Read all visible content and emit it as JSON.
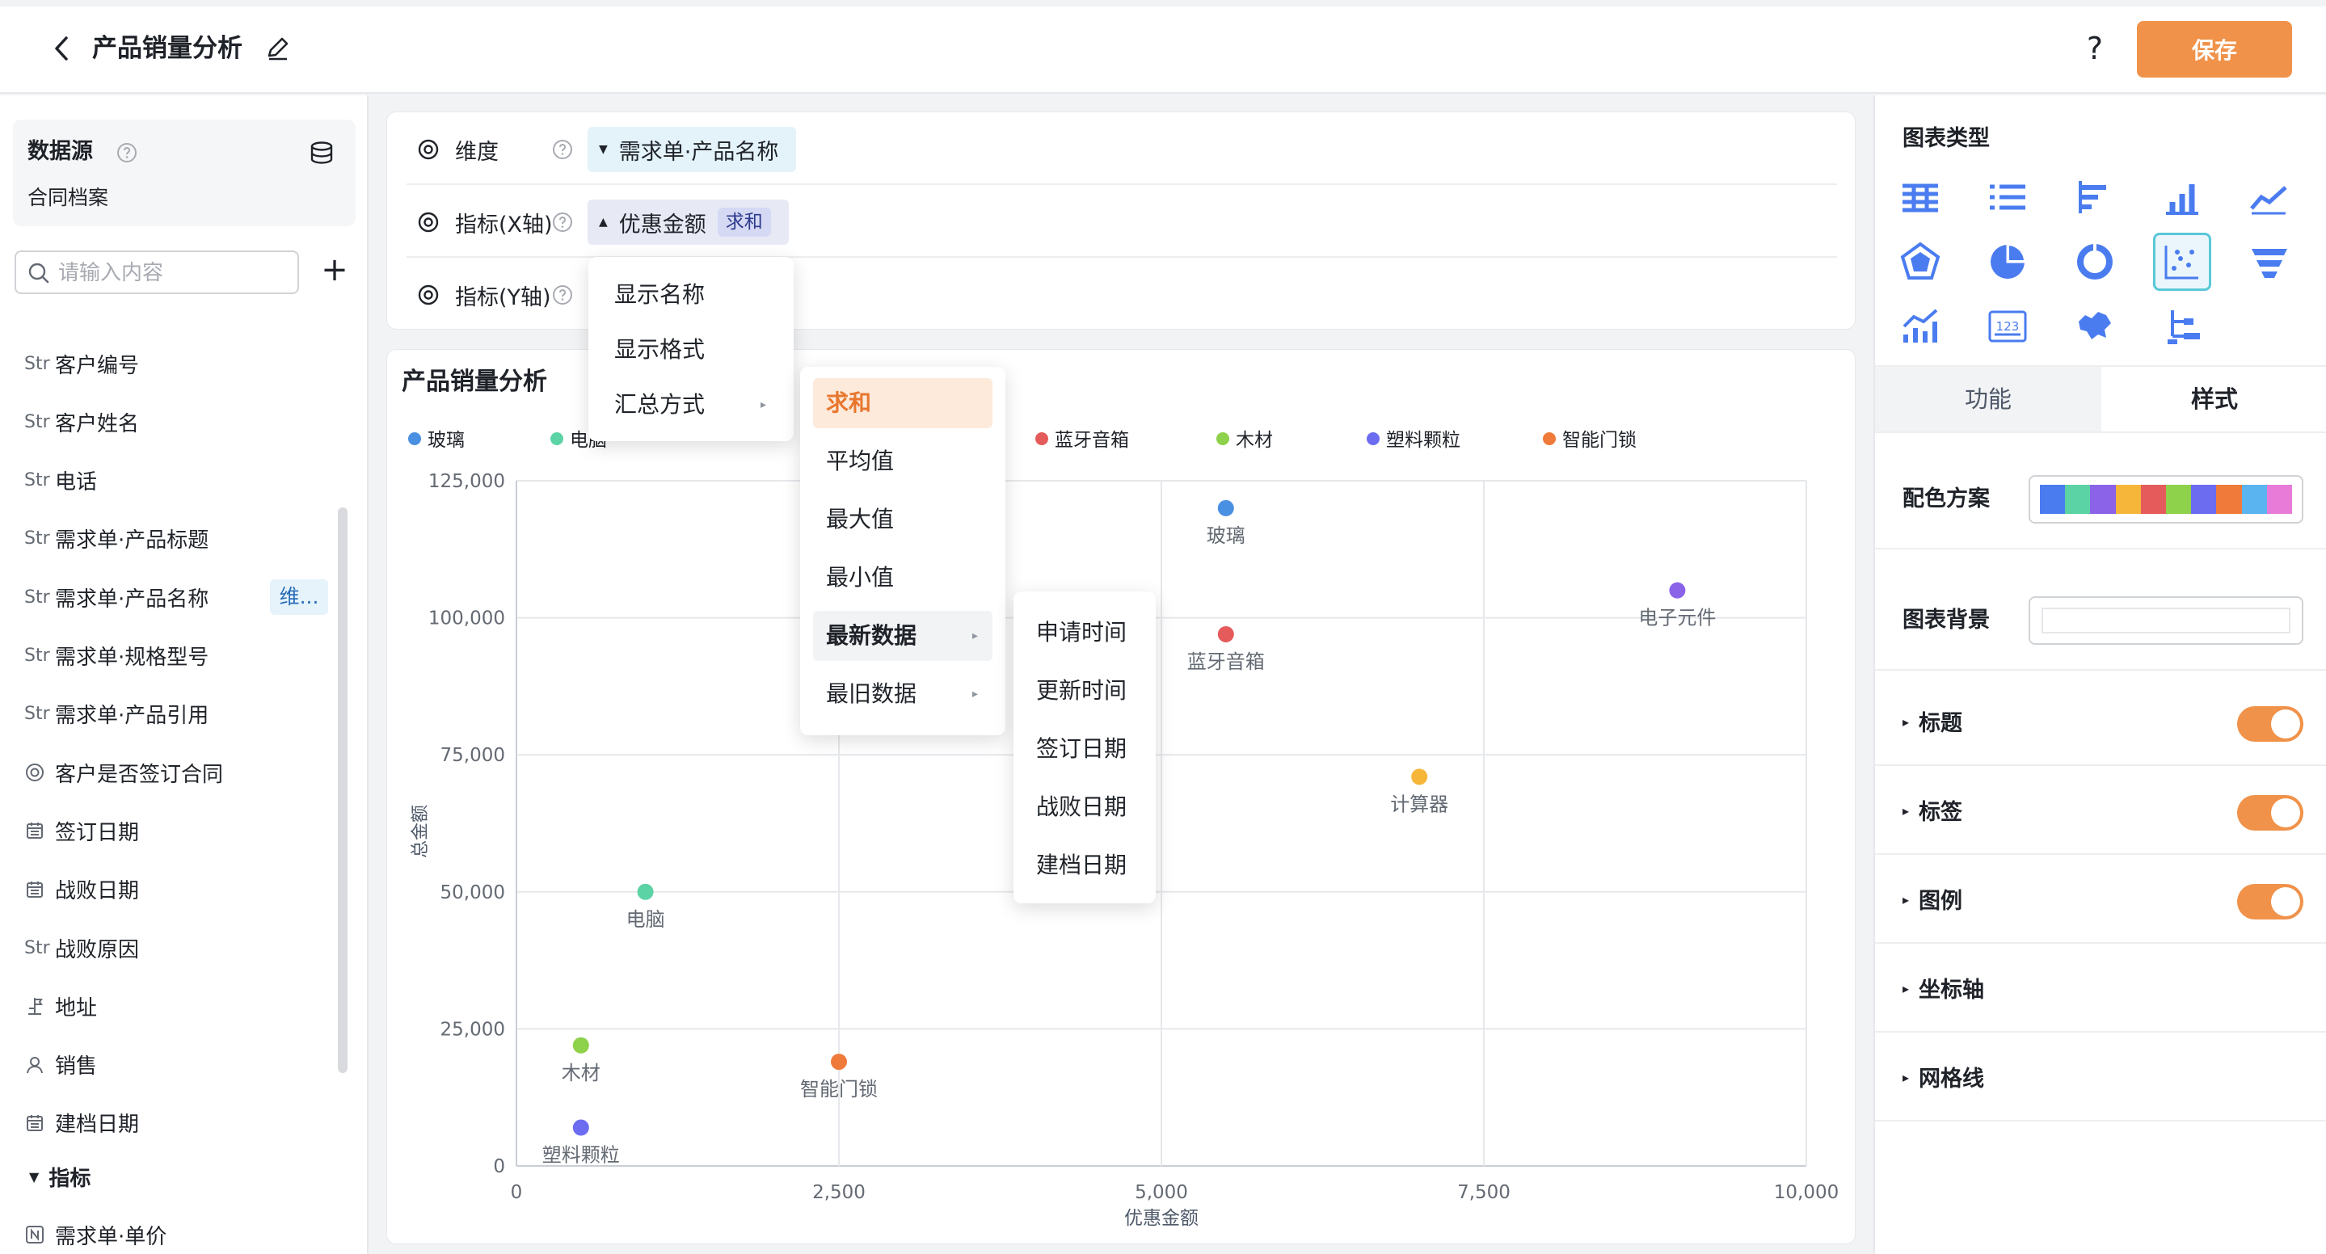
{
  "header": {
    "title": "产品销量分析",
    "help": "?",
    "save_label": "保存"
  },
  "sidebar": {
    "data_source_label": "数据源",
    "data_source_value": "合同档案",
    "search_placeholder": "请输入内容",
    "add": "+",
    "fields": [
      {
        "type": "Str",
        "label": "客户编号"
      },
      {
        "type": "Str",
        "label": "客户姓名"
      },
      {
        "type": "Str",
        "label": "电话"
      },
      {
        "type": "Str",
        "label": "需求单·产品标题"
      },
      {
        "type": "Str",
        "label": "需求单·产品名称",
        "badge": "维..."
      },
      {
        "type": "Str",
        "label": "需求单·规格型号"
      },
      {
        "type": "Str",
        "label": "需求单·产品引用"
      },
      {
        "type": "radio-icon",
        "label": "客户是否签订合同"
      },
      {
        "type": "calendar-icon",
        "label": "签订日期"
      },
      {
        "type": "calendar-icon",
        "label": "战败日期"
      },
      {
        "type": "Str",
        "label": "战败原因"
      },
      {
        "type": "location-icon",
        "label": "地址"
      },
      {
        "type": "user-icon",
        "label": "销售"
      },
      {
        "type": "calendar-icon",
        "label": "建档日期"
      }
    ],
    "metric_section": "指标",
    "metric_fields": [
      {
        "type": "number-icon",
        "label": "需求单·单价"
      }
    ]
  },
  "config": {
    "dimension_label": "维度",
    "dimension_value": "需求单·产品名称",
    "x_label": "指标(X轴)",
    "x_value": "优惠金额",
    "x_agg": "求和",
    "y_label": "指标(Y轴)"
  },
  "menus": {
    "menu1": [
      {
        "label": "显示名称"
      },
      {
        "label": "显示格式"
      },
      {
        "label": "汇总方式",
        "arrow": "▸"
      }
    ],
    "menu2": [
      {
        "label": "求和",
        "state": "active"
      },
      {
        "label": "平均值"
      },
      {
        "label": "最大值"
      },
      {
        "label": "最小值"
      },
      {
        "label": "最新数据",
        "arrow": "▸",
        "state": "hover"
      },
      {
        "label": "最旧数据",
        "arrow": "▸"
      }
    ],
    "menu3": [
      {
        "label": "申请时间"
      },
      {
        "label": "更新时间"
      },
      {
        "label": "签订日期"
      },
      {
        "label": "战败日期"
      },
      {
        "label": "建档日期"
      }
    ]
  },
  "chart": {
    "title": "产品销量分析"
  },
  "chart_data": {
    "type": "scatter",
    "title": "产品销量分析",
    "xlabel": "优惠金额",
    "ylabel": "总金额",
    "xlim": [
      0,
      10000
    ],
    "ylim": [
      0,
      125000
    ],
    "x_ticks": [
      "0",
      "2,500",
      "5,000",
      "7,500",
      "10,000"
    ],
    "y_ticks": [
      "0",
      "25,000",
      "50,000",
      "75,000",
      "100,000",
      "125,000"
    ],
    "grid": true,
    "legend_position": "top",
    "legend": [
      {
        "name": "玻璃",
        "color": "#4a90e2"
      },
      {
        "name": "电脑",
        "color": "#5cd3a4"
      },
      {
        "name": "蓝牙音箱",
        "color": "#e55b5b"
      },
      {
        "name": "木材",
        "color": "#8ed14a"
      },
      {
        "name": "塑料颗粒",
        "color": "#6c6cf0"
      },
      {
        "name": "智能门锁",
        "color": "#f07a3a"
      }
    ],
    "points": [
      {
        "name": "玻璃",
        "x": 5500,
        "y": 120000,
        "color": "#4a90e2"
      },
      {
        "name": "电子元件",
        "x": 9000,
        "y": 105000,
        "color": "#8a63e8"
      },
      {
        "name": "蓝牙音箱",
        "x": 5500,
        "y": 97000,
        "color": "#e55b5b"
      },
      {
        "name": "计算器",
        "x": 7000,
        "y": 71000,
        "color": "#f5b63a"
      },
      {
        "name": "电脑",
        "x": 1000,
        "y": 50000,
        "color": "#5cd3a4"
      },
      {
        "name": "木材",
        "x": 500,
        "y": 22000,
        "color": "#8ed14a"
      },
      {
        "name": "智能门锁",
        "x": 2500,
        "y": 19000,
        "color": "#f07a3a"
      },
      {
        "name": "塑料颗粒",
        "x": 500,
        "y": 7000,
        "color": "#6c6cf0"
      }
    ]
  },
  "right_panel": {
    "chart_type_label": "图表类型",
    "chart_types": [
      "table-icon",
      "list-icon",
      "bar-horizontal-icon",
      "bar-icon",
      "line-icon",
      "radar-icon",
      "pie-icon",
      "donut-icon",
      "scatter-icon",
      "funnel-icon",
      "combo-icon",
      "kpi-number-icon",
      "map-icon",
      "tree-icon"
    ],
    "selected_chart_type": "scatter-icon",
    "kpi_text": "123",
    "tab_function": "功能",
    "tab_style": "样式",
    "palette_label": "配色方案",
    "palette_colors": [
      "#4a7cf0",
      "#5cd3a4",
      "#8a63e8",
      "#f5b63a",
      "#e55b5b",
      "#8ed14a",
      "#6c6cf0",
      "#f07a3a",
      "#5ab4f0",
      "#e87ad8"
    ],
    "background_label": "图表背景",
    "sections": [
      {
        "label": "标题",
        "toggle": true
      },
      {
        "label": "标签",
        "toggle": true
      },
      {
        "label": "图例",
        "toggle": true
      },
      {
        "label": "坐标轴",
        "toggle": false
      },
      {
        "label": "网格线",
        "toggle": false
      }
    ]
  }
}
